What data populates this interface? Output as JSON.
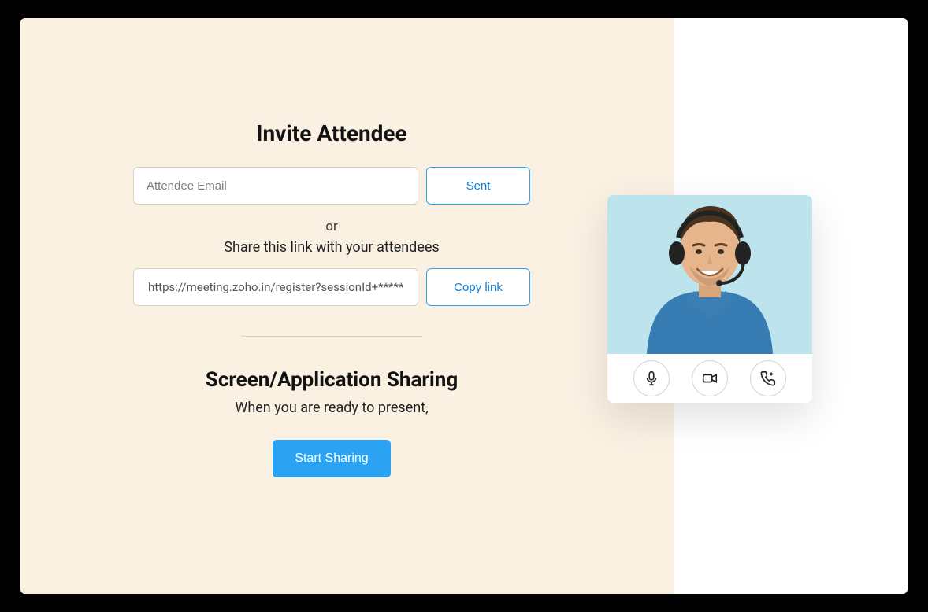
{
  "invite": {
    "title": "Invite Attendee",
    "email_placeholder": "Attendee Email",
    "sent_label": "Sent",
    "or": "or",
    "share_text": "Share this link with your attendees",
    "link_value": "https://meeting.zoho.in/register?sessionId+*****",
    "copy_label": "Copy link"
  },
  "sharing": {
    "title": "Screen/Application Sharing",
    "subtitle": "When you are ready to present,",
    "start_label": "Start Sharing"
  },
  "video": {
    "controls": {
      "mic": "microphone-icon",
      "camera": "video-icon",
      "endcall": "end-call-icon"
    }
  },
  "colors": {
    "accent": "#2ca3f2",
    "panel": "#faf1e3"
  }
}
